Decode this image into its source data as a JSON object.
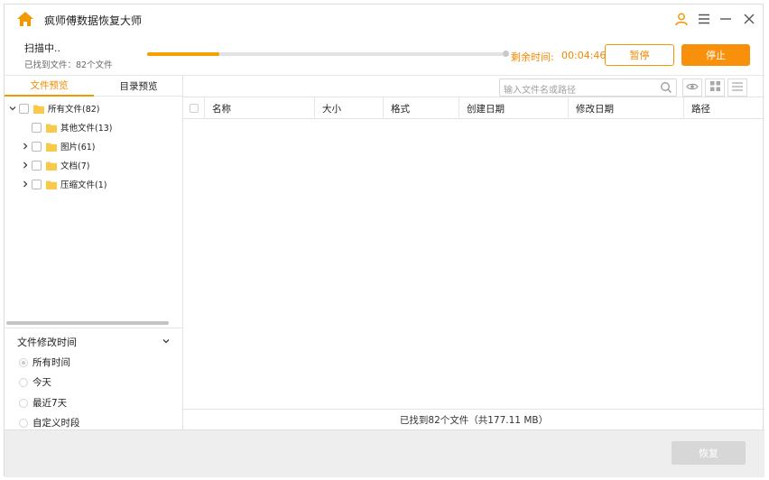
{
  "app": {
    "title": "疯师傅数据恢复大师"
  },
  "scan": {
    "status": "扫描中..",
    "found": "已找到文件：82个文件",
    "progress": 0.2,
    "remaining_label": "剩余时间:",
    "remaining_time": "00:04:46",
    "pause_label": "暂停",
    "stop_label": "停止"
  },
  "tabs": [
    {
      "label": "文件预览",
      "active": true
    },
    {
      "label": "目录预览",
      "active": false
    }
  ],
  "tree": [
    {
      "label": "所有文件(82)",
      "expanded": true,
      "level": 0
    },
    {
      "label": "其他文件(13)",
      "level": 1
    },
    {
      "label": "图片(61)",
      "level": 1,
      "collapsed": true
    },
    {
      "label": "文档(7)",
      "level": 1,
      "collapsed": true
    },
    {
      "label": "压缩文件(1)",
      "level": 1,
      "collapsed": true
    }
  ],
  "filter": {
    "title": "文件修改时间",
    "options": [
      {
        "label": "所有时间",
        "selected": true
      },
      {
        "label": "今天",
        "selected": false
      },
      {
        "label": "最近7天",
        "selected": false
      },
      {
        "label": "自定义时段",
        "selected": false
      }
    ]
  },
  "search": {
    "placeholder": "输入文件名或路径"
  },
  "table": {
    "columns": [
      "名称",
      "大小",
      "格式",
      "创建日期",
      "修改日期",
      "路径"
    ]
  },
  "status_text": "已找到82个文件（共177.11 MB）",
  "footer": {
    "recover_label": "恢复"
  },
  "colors": {
    "accent": "#f39800",
    "accent_text": "#f08a00",
    "folder": "#f9c94a"
  }
}
